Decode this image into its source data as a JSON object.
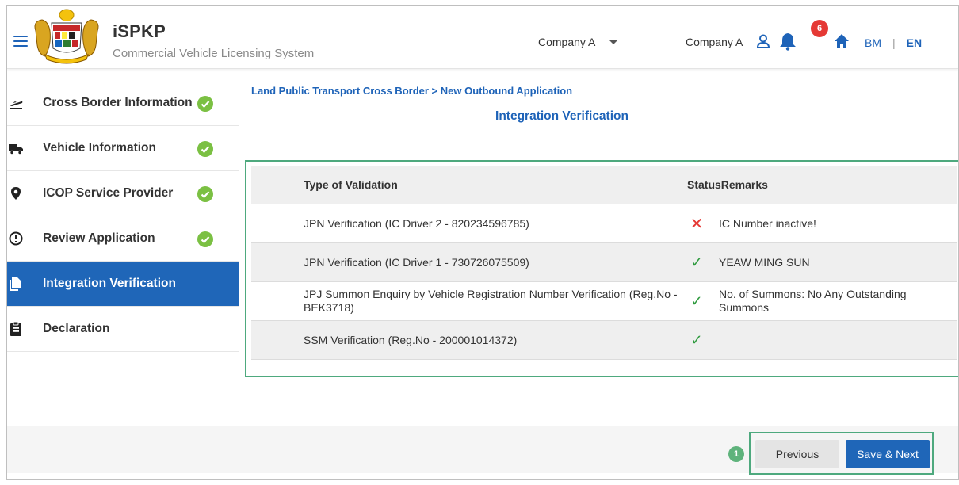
{
  "header": {
    "title": "iSPKP",
    "subtitle": "Commercial Vehicle Licensing System",
    "company_select": "Company A",
    "company_name": "Company A",
    "notification_count": "6",
    "lang_bm": "BM",
    "lang_sep": "|",
    "lang_en": "EN"
  },
  "sidebar": {
    "items": [
      {
        "label": "Cross Border Information",
        "icon": "departure-icon",
        "completed": true
      },
      {
        "label": "Vehicle Information",
        "icon": "truck-icon",
        "completed": true
      },
      {
        "label": "ICOP Service Provider",
        "icon": "location-pin-icon",
        "completed": true
      },
      {
        "label": "Review Application",
        "icon": "info-circle-icon",
        "completed": true
      },
      {
        "label": "Integration Verification",
        "icon": "documents-icon",
        "completed": false,
        "active": true
      },
      {
        "label": "Declaration",
        "icon": "clipboard-icon",
        "completed": false
      }
    ]
  },
  "main": {
    "breadcrumb": "Land Public Transport Cross Border > New Outbound Application",
    "title": "Integration Verification",
    "table": {
      "headers": {
        "type": "Type of Validation",
        "status_remarks": "StatusRemarks"
      },
      "rows": [
        {
          "type": "JPN Verification (IC Driver 2 - 820234596785)",
          "status": "fail",
          "status_glyph": "✕",
          "remarks": "IC Number inactive!"
        },
        {
          "type": "JPN Verification (IC Driver 1 - 730726075509)",
          "status": "pass",
          "status_glyph": "✓",
          "remarks": "YEAW MING SUN"
        },
        {
          "type": "JPJ Summon Enquiry by Vehicle Registration Number Verification (Reg.No - BEK3718)",
          "status": "pass",
          "status_glyph": "✓",
          "remarks": "No. of Summons: No Any Outstanding Summons"
        },
        {
          "type": "SSM Verification (Reg.No - 200001014372)",
          "status": "pass",
          "status_glyph": "✓",
          "remarks": ""
        }
      ]
    }
  },
  "footer": {
    "step_number": "1",
    "previous_label": "Previous",
    "next_label": "Save & Next"
  },
  "colors": {
    "primary": "#1f66b8",
    "success": "#7bc043",
    "error": "#e53935",
    "highlight_border": "#4ea97e"
  }
}
